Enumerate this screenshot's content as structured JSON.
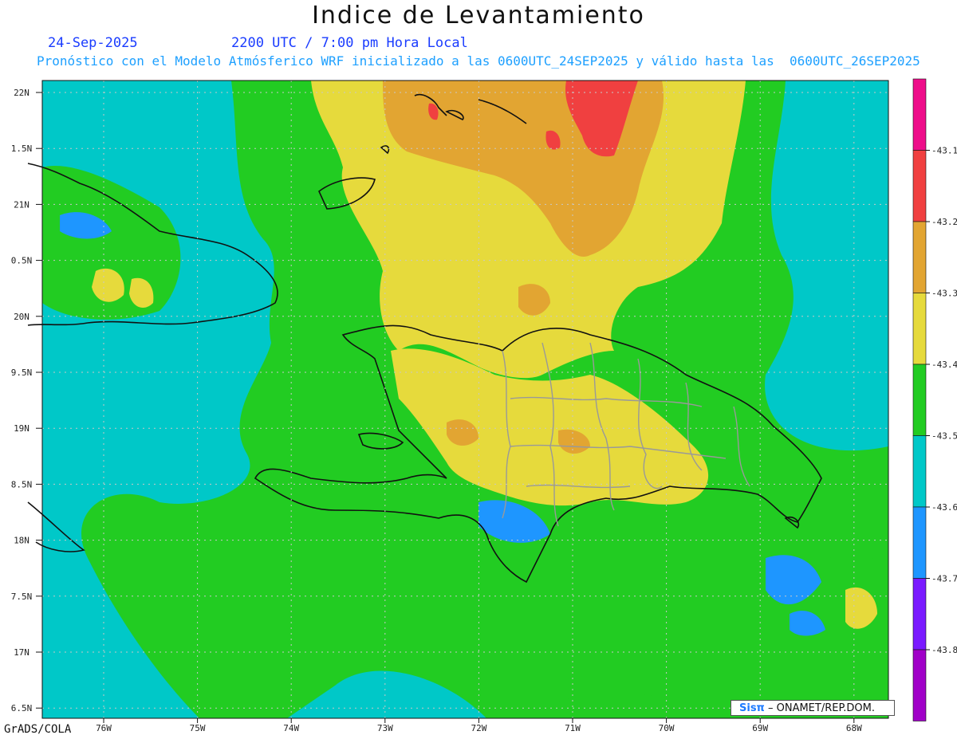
{
  "header": {
    "title": "Indice de Levantamiento",
    "date": "24-Sep-2025",
    "valid_time": "2200 UTC / 7:00 pm Hora Local",
    "description": "Pronóstico con el Modelo Atmósferico WRF inicializado a las 0600UTC_24SEP2025 y válido hasta las  0600UTC_26SEP2025"
  },
  "map": {
    "lat_labels": [
      "22N",
      "1.5N",
      "21N",
      "0.5N",
      "20N",
      "9.5N",
      "19N",
      "8.5N",
      "18N",
      "7.5N",
      "17N",
      "6.5N"
    ],
    "lon_labels": [
      "76W",
      "75W",
      "74W",
      "73W",
      "72W",
      "71W",
      "70W",
      "69W",
      "68W"
    ]
  },
  "colorbar": {
    "colors": [
      "#ee0d8a",
      "#f04040",
      "#e2a532",
      "#e6da3c",
      "#22cc22",
      "#00c8c8",
      "#1e96ff",
      "#7a1aff",
      "#a000c8"
    ],
    "labels": [
      "-43.1",
      "-43.2",
      "-43.3",
      "-43.4",
      "-43.5",
      "-43.6",
      "-43.7",
      "-43.8"
    ]
  },
  "footer": {
    "credit": "GrADS/COLA",
    "badge_logo": "Sisπ",
    "badge_text": "– ONAMET/REP.DOM."
  }
}
